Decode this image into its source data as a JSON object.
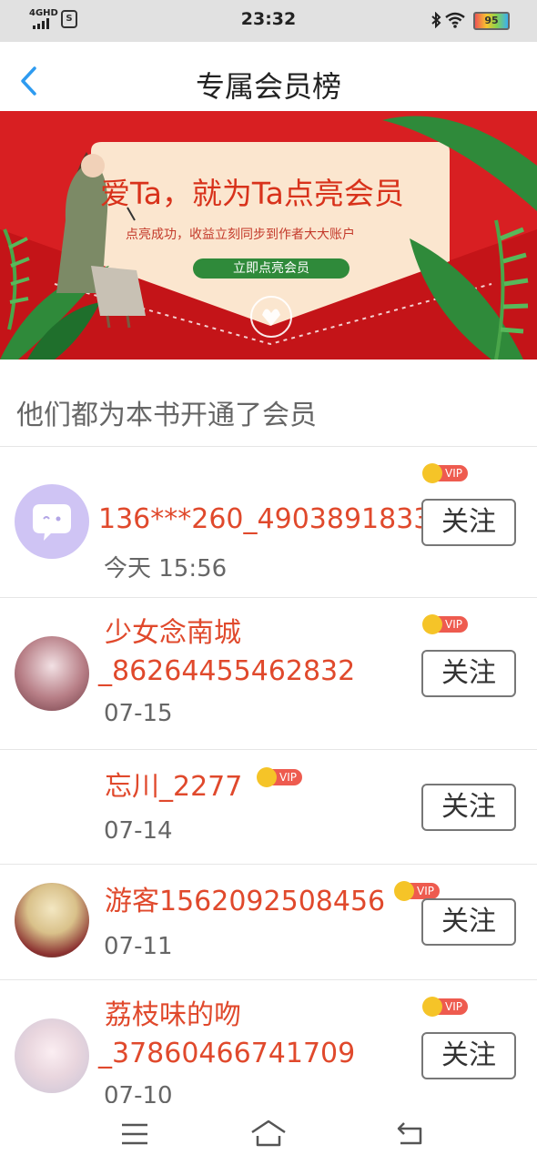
{
  "status_bar": {
    "network": "4GHD",
    "time": "23:32",
    "battery": "95"
  },
  "header": {
    "title": "专属会员榜"
  },
  "banner": {
    "headline": "爱Ta，就为Ta点亮会员",
    "subline": "点亮成功，收益立刻同步到作者大大账户",
    "cta": "立即点亮会员"
  },
  "section": {
    "title": "他们都为本书开通了会员"
  },
  "vip_label": "VIP",
  "follow_label": "关注",
  "members": [
    {
      "name1": "136***260_4903891833",
      "name2": "",
      "date": "今天 15:56"
    },
    {
      "name1": "少女念南城",
      "name2": "_86264455462832",
      "date": "07-15"
    },
    {
      "name1": "忘川_2277",
      "name2": "",
      "date": "07-14"
    },
    {
      "name1": "游客1562092508456",
      "name2": "",
      "date": "07-11"
    },
    {
      "name1": "荔枝味的吻",
      "name2": "_37860466741709",
      "date": "07-10"
    }
  ]
}
